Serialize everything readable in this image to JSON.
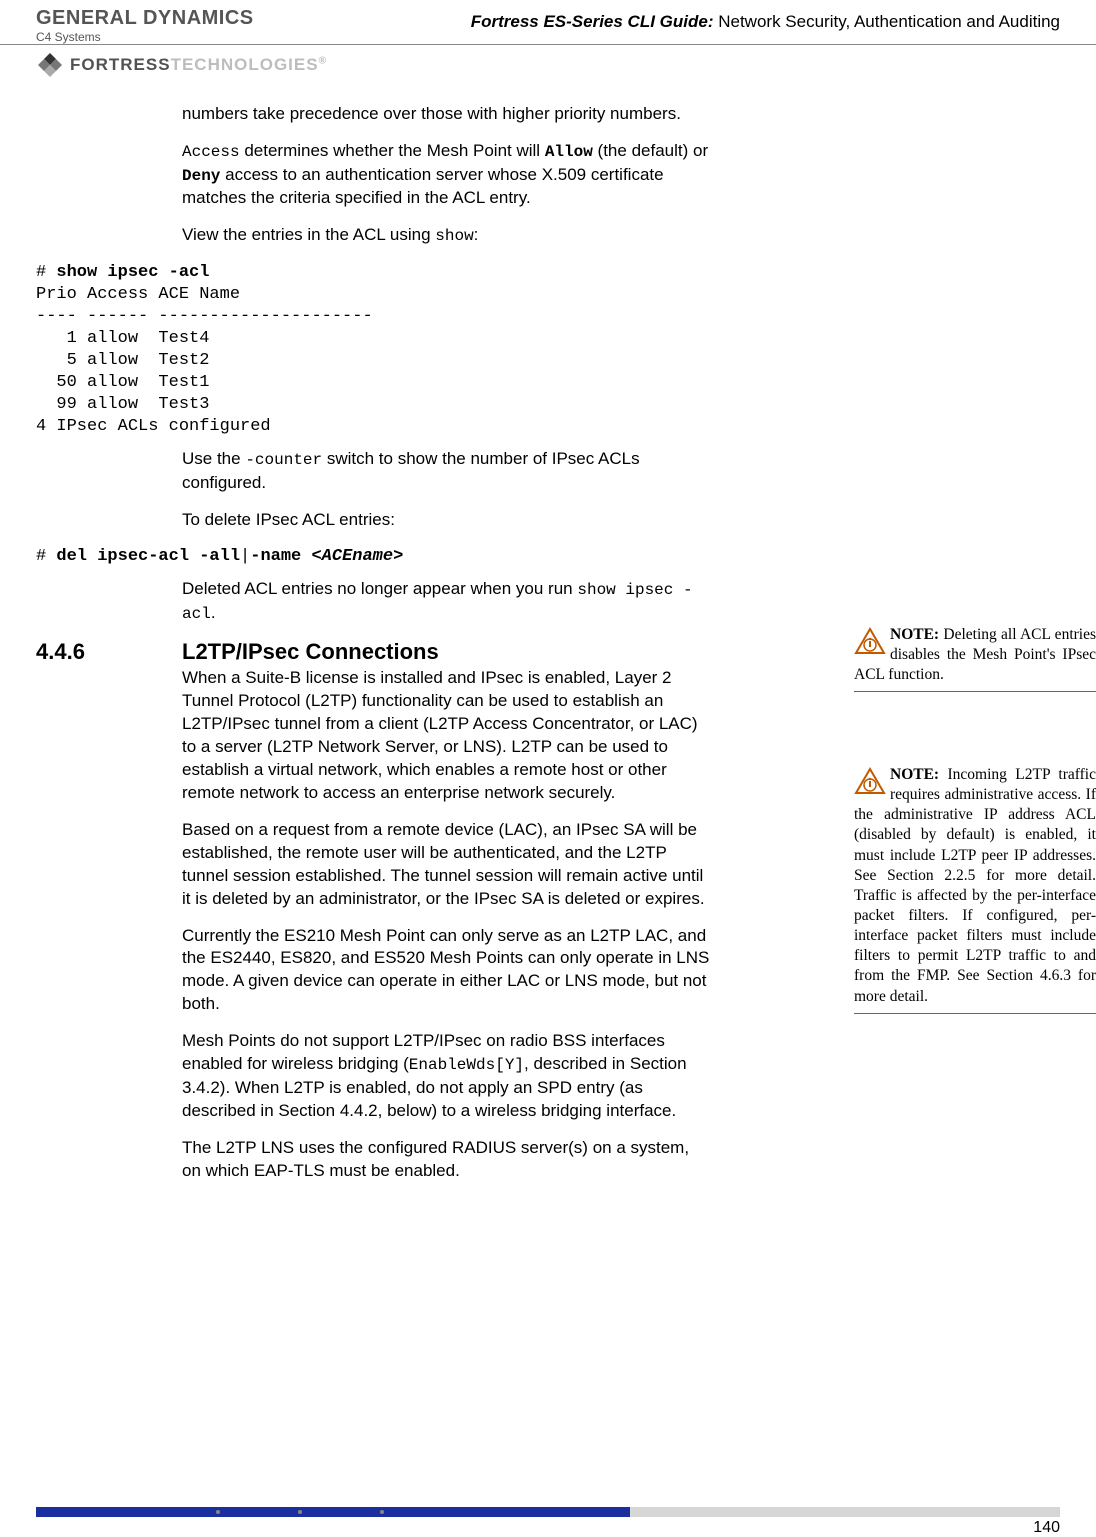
{
  "header": {
    "gd_logo": "GENERAL DYNAMICS",
    "gd_sub": "C4 Systems",
    "guide_title": "Fortress ES-Series CLI Guide:",
    "guide_subtitle": " Network Security, Authentication and Auditing",
    "fortress": "FORTRESS",
    "fortress_light": "TECHNOLOGIES",
    "reg": "®"
  },
  "body": {
    "p1": "numbers take precedence over those with higher priority numbers.",
    "p2a": "Access",
    "p2b": " determines whether the Mesh Point will ",
    "p2c": "Allow",
    "p2d": " (the default) or ",
    "p2e": "Deny",
    "p2f": " access to an authentication server whose X.509 certificate matches the criteria specified in the ACL entry.",
    "p3a": "View the entries in the ACL using ",
    "p3b": "show",
    "p3c": ":",
    "code1_prompt": "# ",
    "code1_cmd": "show ipsec -acl",
    "code1_body": "Prio Access ACE Name\n---- ------ ---------------------\n   1 allow  Test4\n   5 allow  Test2\n  50 allow  Test1\n  99 allow  Test3\n4 IPsec ACLs configured",
    "p4a": "Use the ",
    "p4b": "-counter",
    "p4c": " switch to show the number of IPsec ACLs configured.",
    "p5": "To delete IPsec ACL entries:",
    "code2_prompt": "# ",
    "code2_cmd": "del ipsec-acl -all",
    "code2_pipe": "|",
    "code2_cmd2": "-name ",
    "code2_arg": "<ACEname>",
    "p6a": "Deleted ACL entries no longer appear when you run ",
    "p6b": "show ipsec -acl",
    "p6c": ".",
    "sec_num": "4.4.6",
    "sec_title": "L2TP/IPsec Connections",
    "p7": "When a Suite-B license is installed and IPsec is enabled, Layer 2 Tunnel Protocol (L2TP) functionality can be used to establish an L2TP/IPsec tunnel from a client (L2TP Access Concentrator, or LAC) to a server (L2TP Network Server, or LNS). L2TP can be used to establish a virtual network, which enables a remote host or other remote network to access an enterprise network securely.",
    "p8": "Based on a request from a remote device (LAC), an IPsec SA will be established, the remote user will be authenticated, and the L2TP tunnel session established. The tunnel session will remain active until it is deleted by an administrator, or the IPsec SA is deleted or expires.",
    "p9": "Currently the ES210 Mesh Point can only serve as an L2TP LAC, and the ES2440, ES820, and ES520 Mesh Points can only operate in LNS mode. A given device can operate in either LAC or LNS mode, but not both.",
    "p10a": "Mesh Points do not support L2TP/IPsec on radio BSS interfaces enabled for wireless bridging (",
    "p10b": "EnableWds[Y]",
    "p10c": ", described in Section 3.4.2). When L2TP is enabled, do not apply an SPD entry (as described in Section 4.4.2, below) to a wireless bridging interface.",
    "p11": "The L2TP LNS uses the configured RADIUS server(s) on a system, on which EAP-TLS must be enabled."
  },
  "notes": {
    "n1_label": "NOTE:",
    "n1_text": " Deleting all ACL entries disables the Mesh Point's IPsec ACL function.",
    "n2_label": "NOTE:",
    "n2_text": " Incoming L2TP traffic requires administrative access. If the administrative IP address ACL (disabled by default) is enabled, it must include L2TP peer IP addresses. See Section 2.2.5 for more detail. Traffic is affected by the per-interface packet filters. If configured, per-interface packet filters must include filters to permit L2TP traffic to and from the FMP. See Section 4.6.3 for more detail."
  },
  "page_number": "140",
  "chart_data": {
    "type": "table",
    "title": "IPsec ACL entries",
    "columns": [
      "Prio",
      "Access",
      "ACE Name"
    ],
    "rows": [
      [
        1,
        "allow",
        "Test4"
      ],
      [
        5,
        "allow",
        "Test2"
      ],
      [
        50,
        "allow",
        "Test1"
      ],
      [
        99,
        "allow",
        "Test3"
      ]
    ],
    "footer": "4 IPsec ACLs configured"
  }
}
